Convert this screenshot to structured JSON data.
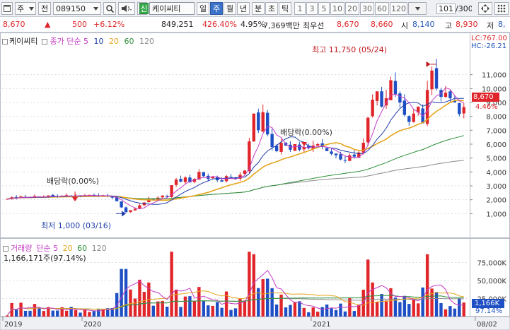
{
  "toolbar": {
    "market_select": "주",
    "prefix_label": "전",
    "code": "089150",
    "new_badge": "신",
    "stock_name": "케이씨티",
    "periods": [
      "일",
      "주",
      "월",
      "년",
      "분",
      "초",
      "틱"
    ],
    "active_period": "주",
    "intervals": [
      "1",
      "3",
      "5",
      "10",
      "20",
      "30",
      "60",
      "120"
    ],
    "count": "101",
    "total": "/300",
    "colors": {
      "active": "#3a73c9",
      "new_badge": "#36a84a"
    },
    "icons": [
      "search-icon",
      "speaker-icon",
      "next-icon",
      "dropdown-icon",
      "arrows-icon"
    ]
  },
  "quote": {
    "price": "8,670",
    "change_arrow": "▲",
    "change": "500",
    "change_pct": "+6.12%",
    "volume": "849,251",
    "volume_ratio": "426.40%",
    "turnover": "4.95%",
    "trade_value": "7,369백만",
    "best_label": "최우선",
    "ask": "8,670",
    "bid": "8,660",
    "open_label": "시",
    "open": "8,140",
    "high_label": "고",
    "high": "8,930",
    "low_label": "저",
    "low": "8,"
  },
  "price_panel": {
    "title": "케이씨티",
    "legend_main": "종가 단순 5",
    "legend_ma10": "10",
    "legend_ma20": "20",
    "legend_ma60": "60",
    "legend_ma120": "120",
    "lc_label": "LC:767.00",
    "hc_label": "HC:-26.21",
    "current_price_tag": "8,670",
    "current_pct_tag": "4.46%",
    "annotations": {
      "high_label": "최고 11,750 (05/24)",
      "low_label": "최저 1,000 (03/16)",
      "dividend1": "배당락(0.00%)",
      "dividend2": "배당락(0.00%)"
    },
    "y_ticks": [
      "11,000",
      "10,000",
      "9,000",
      "8,000",
      "7,000",
      "6,000",
      "5,000",
      "4,000",
      "3,000",
      "2,000",
      "1,000"
    ],
    "colors": {
      "up": "#e0262b",
      "down": "#1f4fc4",
      "ma5": "#c43cc4",
      "ma10": "#1f3ca8",
      "ma20": "#e5a51d",
      "ma60": "#2f8f3a",
      "ma120": "#8a8a8a"
    }
  },
  "volume_panel": {
    "legend_title": "거래량",
    "legend_main": "단순 5",
    "legend_ma20": "20",
    "legend_ma60": "60",
    "legend_ma120": "120",
    "current_volume": "1,166,171주(97.14%)",
    "current_tag": "1,166K",
    "current_pct_tag": "97.14%",
    "y_ticks": [
      "75,000K",
      "50,000K",
      "25,000K"
    ]
  },
  "x_axis": {
    "labels": [
      "2019",
      "2020",
      "2021",
      "08/02"
    ]
  },
  "chart_data": {
    "type": "candlestick",
    "period": "weekly",
    "x": [
      "2019",
      "2019",
      "2019",
      "2019",
      "2019",
      "2019",
      "2019",
      "2019",
      "2019",
      "2019",
      "2019",
      "2019",
      "2019",
      "2019",
      "2019",
      "2019",
      "2019",
      "2019",
      "2020",
      "2020",
      "2020",
      "2020",
      "2020",
      "2020",
      "2020",
      "2020",
      "2020",
      "2020",
      "2020",
      "2020",
      "2020",
      "2020",
      "2020",
      "2020",
      "2020",
      "2020",
      "2020",
      "2020",
      "2020",
      "2020",
      "2020",
      "2020",
      "2020",
      "2020",
      "2020",
      "2020",
      "2020",
      "2020",
      "2020",
      "2020",
      "2020",
      "2020",
      "2020",
      "2020",
      "2020",
      "2020",
      "2020",
      "2020",
      "2020",
      "2020",
      "2020",
      "2020",
      "2020",
      "2020",
      "2020",
      "2020",
      "2020",
      "2020",
      "2020",
      "2020",
      "2021",
      "2021",
      "2021",
      "2021",
      "2021",
      "2021",
      "2021",
      "2021",
      "2021",
      "2021",
      "2021",
      "2021",
      "2021",
      "2021",
      "2021",
      "2021",
      "2021",
      "2021",
      "2021",
      "2021",
      "2021",
      "2021",
      "2021",
      "2021",
      "2021",
      "2021",
      "2021",
      "2021",
      "2021",
      "2021",
      "2021"
    ],
    "close": [
      2060,
      2180,
      2120,
      2240,
      2200,
      2150,
      2260,
      2180,
      2230,
      2310,
      2260,
      2200,
      2280,
      2330,
      2250,
      2300,
      2270,
      2320,
      2350,
      2290,
      2240,
      2310,
      2220,
      2150,
      1900,
      1450,
      1100,
      1250,
      1350,
      1600,
      1800,
      2100,
      2000,
      2150,
      2300,
      2200,
      3050,
      3450,
      3300,
      3600,
      3250,
      3500,
      4000,
      3700,
      3500,
      3650,
      3400,
      3300,
      3700,
      3600,
      3500,
      3800,
      4100,
      6200,
      8200,
      7000,
      8300,
      6700,
      5800,
      5500,
      6100,
      5900,
      5600,
      6000,
      5600,
      5800,
      5700,
      5900,
      6000,
      5800,
      5500,
      5300,
      5200,
      4900,
      4800,
      5200,
      5100,
      5400,
      6100,
      7900,
      9200,
      9800,
      8700,
      9300,
      10600,
      9600,
      9000,
      8100,
      7600,
      8200,
      8700,
      7500,
      9900,
      11300,
      10000,
      9400,
      9700,
      9300,
      9000,
      8170,
      8670
    ],
    "ma20_note": "moving averages drawn: 5, 10, 20, 60, 120",
    "high_marker": {
      "price": 11750,
      "date": "05/24"
    },
    "low_marker": {
      "price": 1000,
      "date": "03/16"
    },
    "volume_ticks_k": [
      25000,
      50000,
      75000
    ],
    "price_ylim": [
      0,
      12000
    ]
  }
}
